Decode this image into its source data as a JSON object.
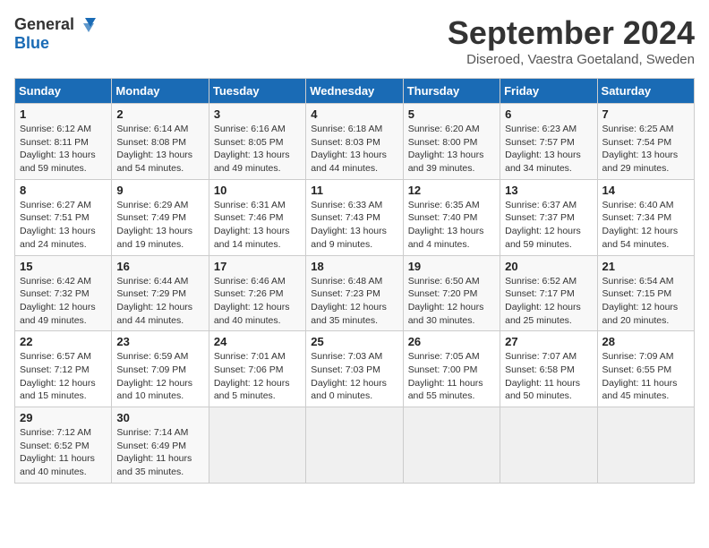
{
  "header": {
    "logo_line1": "General",
    "logo_line2": "Blue",
    "month_title": "September 2024",
    "location": "Diseroed, Vaestra Goetaland, Sweden"
  },
  "weekdays": [
    "Sunday",
    "Monday",
    "Tuesday",
    "Wednesday",
    "Thursday",
    "Friday",
    "Saturday"
  ],
  "weeks": [
    [
      {
        "day": "1",
        "sunrise": "Sunrise: 6:12 AM",
        "sunset": "Sunset: 8:11 PM",
        "daylight": "Daylight: 13 hours and 59 minutes."
      },
      {
        "day": "2",
        "sunrise": "Sunrise: 6:14 AM",
        "sunset": "Sunset: 8:08 PM",
        "daylight": "Daylight: 13 hours and 54 minutes."
      },
      {
        "day": "3",
        "sunrise": "Sunrise: 6:16 AM",
        "sunset": "Sunset: 8:05 PM",
        "daylight": "Daylight: 13 hours and 49 minutes."
      },
      {
        "day": "4",
        "sunrise": "Sunrise: 6:18 AM",
        "sunset": "Sunset: 8:03 PM",
        "daylight": "Daylight: 13 hours and 44 minutes."
      },
      {
        "day": "5",
        "sunrise": "Sunrise: 6:20 AM",
        "sunset": "Sunset: 8:00 PM",
        "daylight": "Daylight: 13 hours and 39 minutes."
      },
      {
        "day": "6",
        "sunrise": "Sunrise: 6:23 AM",
        "sunset": "Sunset: 7:57 PM",
        "daylight": "Daylight: 13 hours and 34 minutes."
      },
      {
        "day": "7",
        "sunrise": "Sunrise: 6:25 AM",
        "sunset": "Sunset: 7:54 PM",
        "daylight": "Daylight: 13 hours and 29 minutes."
      }
    ],
    [
      {
        "day": "8",
        "sunrise": "Sunrise: 6:27 AM",
        "sunset": "Sunset: 7:51 PM",
        "daylight": "Daylight: 13 hours and 24 minutes."
      },
      {
        "day": "9",
        "sunrise": "Sunrise: 6:29 AM",
        "sunset": "Sunset: 7:49 PM",
        "daylight": "Daylight: 13 hours and 19 minutes."
      },
      {
        "day": "10",
        "sunrise": "Sunrise: 6:31 AM",
        "sunset": "Sunset: 7:46 PM",
        "daylight": "Daylight: 13 hours and 14 minutes."
      },
      {
        "day": "11",
        "sunrise": "Sunrise: 6:33 AM",
        "sunset": "Sunset: 7:43 PM",
        "daylight": "Daylight: 13 hours and 9 minutes."
      },
      {
        "day": "12",
        "sunrise": "Sunrise: 6:35 AM",
        "sunset": "Sunset: 7:40 PM",
        "daylight": "Daylight: 13 hours and 4 minutes."
      },
      {
        "day": "13",
        "sunrise": "Sunrise: 6:37 AM",
        "sunset": "Sunset: 7:37 PM",
        "daylight": "Daylight: 12 hours and 59 minutes."
      },
      {
        "day": "14",
        "sunrise": "Sunrise: 6:40 AM",
        "sunset": "Sunset: 7:34 PM",
        "daylight": "Daylight: 12 hours and 54 minutes."
      }
    ],
    [
      {
        "day": "15",
        "sunrise": "Sunrise: 6:42 AM",
        "sunset": "Sunset: 7:32 PM",
        "daylight": "Daylight: 12 hours and 49 minutes."
      },
      {
        "day": "16",
        "sunrise": "Sunrise: 6:44 AM",
        "sunset": "Sunset: 7:29 PM",
        "daylight": "Daylight: 12 hours and 44 minutes."
      },
      {
        "day": "17",
        "sunrise": "Sunrise: 6:46 AM",
        "sunset": "Sunset: 7:26 PM",
        "daylight": "Daylight: 12 hours and 40 minutes."
      },
      {
        "day": "18",
        "sunrise": "Sunrise: 6:48 AM",
        "sunset": "Sunset: 7:23 PM",
        "daylight": "Daylight: 12 hours and 35 minutes."
      },
      {
        "day": "19",
        "sunrise": "Sunrise: 6:50 AM",
        "sunset": "Sunset: 7:20 PM",
        "daylight": "Daylight: 12 hours and 30 minutes."
      },
      {
        "day": "20",
        "sunrise": "Sunrise: 6:52 AM",
        "sunset": "Sunset: 7:17 PM",
        "daylight": "Daylight: 12 hours and 25 minutes."
      },
      {
        "day": "21",
        "sunrise": "Sunrise: 6:54 AM",
        "sunset": "Sunset: 7:15 PM",
        "daylight": "Daylight: 12 hours and 20 minutes."
      }
    ],
    [
      {
        "day": "22",
        "sunrise": "Sunrise: 6:57 AM",
        "sunset": "Sunset: 7:12 PM",
        "daylight": "Daylight: 12 hours and 15 minutes."
      },
      {
        "day": "23",
        "sunrise": "Sunrise: 6:59 AM",
        "sunset": "Sunset: 7:09 PM",
        "daylight": "Daylight: 12 hours and 10 minutes."
      },
      {
        "day": "24",
        "sunrise": "Sunrise: 7:01 AM",
        "sunset": "Sunset: 7:06 PM",
        "daylight": "Daylight: 12 hours and 5 minutes."
      },
      {
        "day": "25",
        "sunrise": "Sunrise: 7:03 AM",
        "sunset": "Sunset: 7:03 PM",
        "daylight": "Daylight: 12 hours and 0 minutes."
      },
      {
        "day": "26",
        "sunrise": "Sunrise: 7:05 AM",
        "sunset": "Sunset: 7:00 PM",
        "daylight": "Daylight: 11 hours and 55 minutes."
      },
      {
        "day": "27",
        "sunrise": "Sunrise: 7:07 AM",
        "sunset": "Sunset: 6:58 PM",
        "daylight": "Daylight: 11 hours and 50 minutes."
      },
      {
        "day": "28",
        "sunrise": "Sunrise: 7:09 AM",
        "sunset": "Sunset: 6:55 PM",
        "daylight": "Daylight: 11 hours and 45 minutes."
      }
    ],
    [
      {
        "day": "29",
        "sunrise": "Sunrise: 7:12 AM",
        "sunset": "Sunset: 6:52 PM",
        "daylight": "Daylight: 11 hours and 40 minutes."
      },
      {
        "day": "30",
        "sunrise": "Sunrise: 7:14 AM",
        "sunset": "Sunset: 6:49 PM",
        "daylight": "Daylight: 11 hours and 35 minutes."
      },
      null,
      null,
      null,
      null,
      null
    ]
  ]
}
